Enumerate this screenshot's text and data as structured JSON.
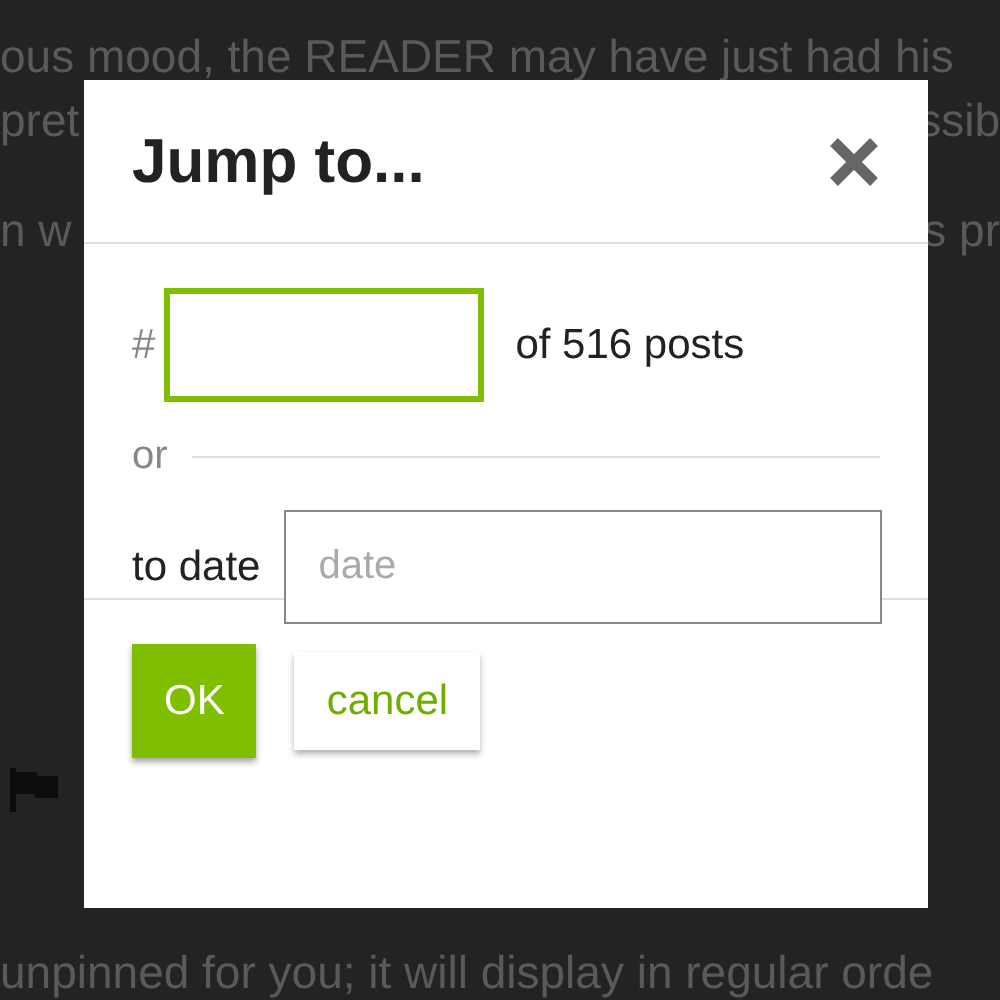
{
  "background": {
    "lines": [
      {
        "left": "ous mood, the READER may have just had his"
      },
      {
        "left": "pret",
        "right": "ssib"
      },
      {
        "left": "n w",
        "right": "s pr"
      },
      {
        "left": "unpinned for you; it will display in regular orde"
      }
    ]
  },
  "dialog": {
    "title": "Jump to...",
    "post_number": {
      "prefix": "#",
      "focused": true,
      "suffix": "of 516 posts"
    },
    "separator": "or",
    "date": {
      "label": "to date",
      "placeholder": "date"
    },
    "buttons": [
      {
        "label": "OK",
        "kind": "primary"
      },
      {
        "label": "cancel",
        "kind": "secondary"
      }
    ]
  }
}
